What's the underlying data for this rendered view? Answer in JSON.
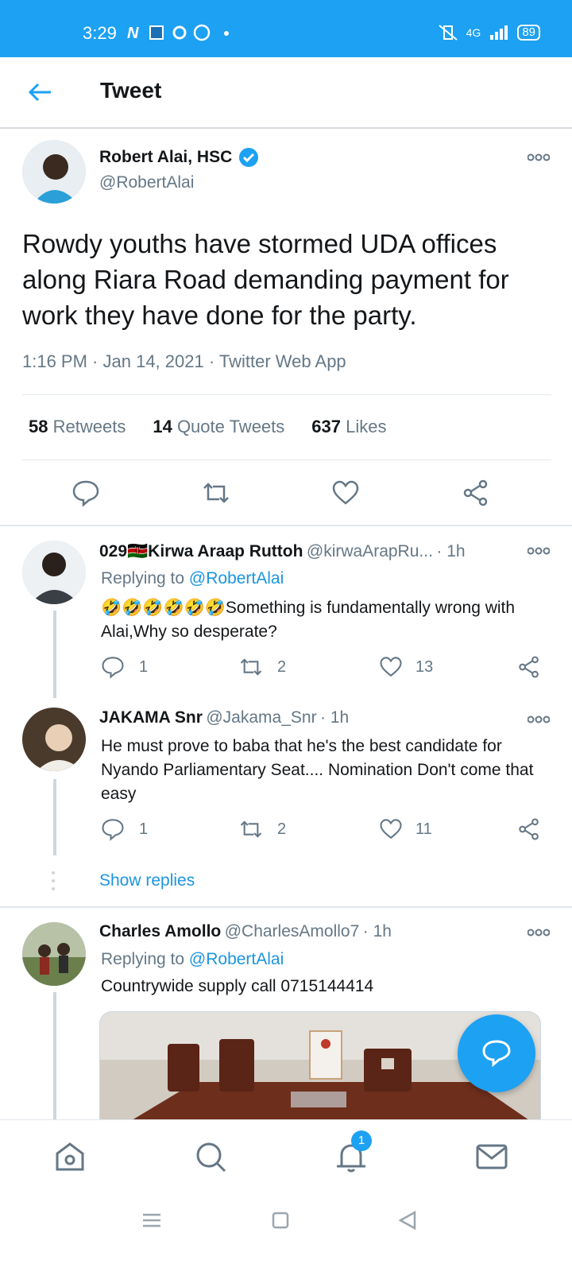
{
  "status_bar": {
    "time": "3:29",
    "battery": "89",
    "network": "4G"
  },
  "header": {
    "title": "Tweet"
  },
  "main_tweet": {
    "author_name": "Robert Alai, HSC",
    "author_handle": "@RobertAlai",
    "text": "Rowdy youths have stormed UDA offices along Riara Road demanding payment for work they have done for the party.",
    "time": "1:16 PM",
    "date": "Jan 14, 2021",
    "source": "Twitter Web App",
    "stats": {
      "retweets_count": "58",
      "retweets_label": "Retweets",
      "quotes_count": "14",
      "quotes_label": "Quote Tweets",
      "likes_count": "637",
      "likes_label": "Likes"
    }
  },
  "replies": [
    {
      "name": "029🇰🇪Kirwa Araap Ruttoh",
      "handle": "@kirwaArapRu...",
      "time": "1h",
      "replying_label": "Replying to",
      "replying_handle": "@RobertAlai",
      "text": "🤣🤣🤣🤣🤣🤣Something is fundamentally wrong with Alai,Why so desperate?",
      "replies": "1",
      "retweets": "2",
      "likes": "13"
    },
    {
      "name": "JAKAMA Snr",
      "handle": "@Jakama_Snr",
      "time": "1h",
      "text": "He must prove to baba that he's the best candidate for Nyando Parliamentary Seat.... Nomination Don't come that easy",
      "replies": "1",
      "retweets": "2",
      "likes": "11",
      "show_replies": "Show replies"
    },
    {
      "name": "Charles Amollo",
      "handle": "@CharlesAmollo7",
      "time": "1h",
      "replying_label": "Replying to",
      "replying_handle": "@RobertAlai",
      "text": "Countrywide supply call 0715144414"
    }
  ],
  "notifications_badge": "1",
  "colors": {
    "accent": "#1da1f2",
    "secondary_text": "#657786",
    "link": "#1b95e0"
  }
}
